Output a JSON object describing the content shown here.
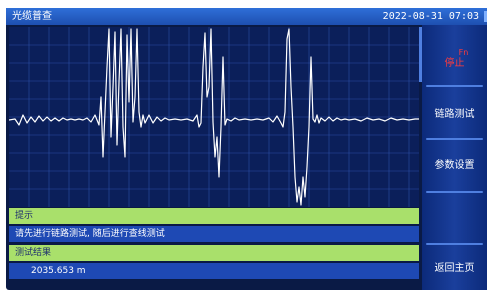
{
  "header": {
    "title": "光缆普查",
    "datetime": "2022-08-31 07:03",
    "indicator_icon": "signal-icon"
  },
  "sidebar": {
    "fn_label": "Fn",
    "stop_label": "停止",
    "link_test_label": "链路测试",
    "params_label": "参数设置",
    "home_label": "返回主页"
  },
  "panel": {
    "hint_title": "提示",
    "hint_text": "请先进行链路测试, 随后进行查线测试",
    "result_title": "测试结果",
    "result_value": "2035.653 m"
  },
  "colors": {
    "background": "#0a1a45",
    "plot_bg": "#0b1f5a",
    "grid": "#2c4fa6",
    "trace": "#ffffff",
    "hint_bar": "#a9e06b",
    "info_bar": "#1e49b4",
    "stop_red": "#ff3b3b"
  }
}
